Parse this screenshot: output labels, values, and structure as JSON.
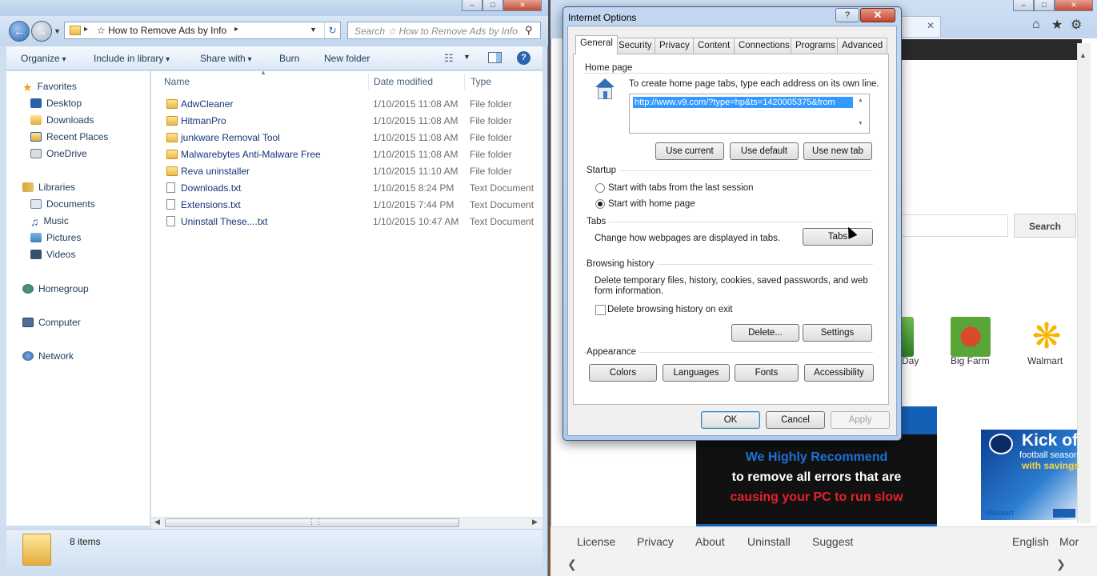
{
  "explorer": {
    "address": "☆ How to Remove Ads by Info",
    "search_placeholder": "Search ☆ How to Remove Ads by Info",
    "toolbar": {
      "organize": "Organize",
      "include_in_library": "Include in library",
      "share_with": "Share with",
      "burn": "Burn",
      "new_folder": "New folder"
    },
    "nav": {
      "favorites": "Favorites",
      "desktop": "Desktop",
      "downloads": "Downloads",
      "recent_places": "Recent Places",
      "onedrive": "OneDrive",
      "libraries": "Libraries",
      "documents": "Documents",
      "music": "Music",
      "pictures": "Pictures",
      "videos": "Videos",
      "homegroup": "Homegroup",
      "computer": "Computer",
      "network": "Network"
    },
    "columns": {
      "name": "Name",
      "date_modified": "Date modified",
      "type": "Type"
    },
    "files": [
      {
        "name": "AdwCleaner",
        "date": "1/10/2015 11:08 AM",
        "type": "File folder",
        "kind": "folder"
      },
      {
        "name": "HitmanPro",
        "date": "1/10/2015 11:08 AM",
        "type": "File folder",
        "kind": "folder"
      },
      {
        "name": "junkware Removal Tool",
        "date": "1/10/2015 11:08 AM",
        "type": "File folder",
        "kind": "folder"
      },
      {
        "name": "Malwarebytes Anti-Malware Free",
        "date": "1/10/2015 11:08 AM",
        "type": "File folder",
        "kind": "folder"
      },
      {
        "name": "Reva uninstaller",
        "date": "1/10/2015 11:10 AM",
        "type": "File folder",
        "kind": "folder"
      },
      {
        "name": "Downloads.txt",
        "date": "1/10/2015 8:24 PM",
        "type": "Text Document",
        "kind": "txt"
      },
      {
        "name": "Extensions.txt",
        "date": "1/10/2015 7:44 PM",
        "type": "Text Document",
        "kind": "txt"
      },
      {
        "name": "Uninstall These....txt",
        "date": "1/10/2015 10:47 AM",
        "type": "Text Document",
        "kind": "txt"
      }
    ],
    "status": "8 items"
  },
  "browser": {
    "search_button": "Search",
    "tiles": [
      {
        "label": "e Day",
        "icon": "green-tile-icon"
      },
      {
        "label": "Big Farm",
        "icon": "big-farm-icon"
      },
      {
        "label": "Walmart",
        "icon": "walmart-icon"
      }
    ],
    "ad": {
      "line1": "We Highly Recommend",
      "line2": "to remove all errors that are",
      "line3": "causing your PC to run slow"
    },
    "promo": {
      "headline": "Kick of",
      "sub1": "football season",
      "sub2": "with savings",
      "brand": "Walmart"
    },
    "footer": [
      "License",
      "Privacy",
      "About",
      "Uninstall",
      "Suggest"
    ],
    "language": "English",
    "more": "Mor"
  },
  "dialog": {
    "title": "Internet Options",
    "help": "?",
    "close": "✕",
    "tabs": [
      "General",
      "Security",
      "Privacy",
      "Content",
      "Connections",
      "Programs",
      "Advanced"
    ],
    "home_page": {
      "heading": "Home page",
      "instruction": "To create home page tabs, type each address on its own line.",
      "url": "http://www.v9.com/?type=hp&ts=1420005375&from",
      "use_current": "Use current",
      "use_default": "Use default",
      "use_new_tab": "Use new tab"
    },
    "startup": {
      "heading": "Startup",
      "option_last_session": "Start with tabs from the last session",
      "option_home_page": "Start with home page",
      "selected": "home_page"
    },
    "tabs_section": {
      "heading": "Tabs",
      "description": "Change how webpages are displayed in tabs.",
      "button": "Tabs"
    },
    "browsing_history": {
      "heading": "Browsing history",
      "description_line1": "Delete temporary files, history, cookies, saved passwords, and web",
      "description_line2": "form information.",
      "delete_on_exit": "Delete browsing history on exit",
      "delete_on_exit_checked": false,
      "delete_button": "Delete...",
      "settings_button": "Settings"
    },
    "appearance": {
      "heading": "Appearance",
      "colors": "Colors",
      "languages": "Languages",
      "fonts": "Fonts",
      "accessibility": "Accessibility"
    },
    "ok": "OK",
    "cancel": "Cancel",
    "apply": "Apply"
  },
  "colors": {
    "selection": "#3399ff",
    "link": "#13357a",
    "ad_blue": "#1a73d9",
    "ad_red": "#e8202a"
  }
}
